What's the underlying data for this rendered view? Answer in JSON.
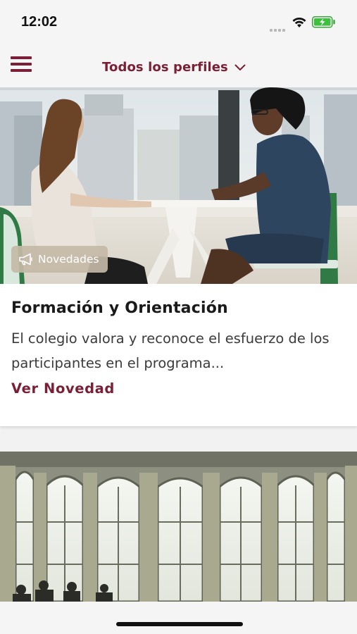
{
  "status": {
    "time": "12:02"
  },
  "header": {
    "profile_selector": "Todos los perfiles"
  },
  "cards": [
    {
      "badge": "Novedades",
      "title": "Formación y Orientación",
      "excerpt": "El colegio valora y reconoce el esfuerzo de los participantes en el programa...",
      "link": "Ver Novedad"
    }
  ],
  "colors": {
    "brand": "#7a1f35",
    "background": "#f3f2f2",
    "card": "#ffffff",
    "badge": "#c4b8a6"
  },
  "icons": [
    "wifi-icon",
    "battery-icon",
    "menu-icon",
    "chevron-down-icon",
    "megaphone-icon"
  ]
}
